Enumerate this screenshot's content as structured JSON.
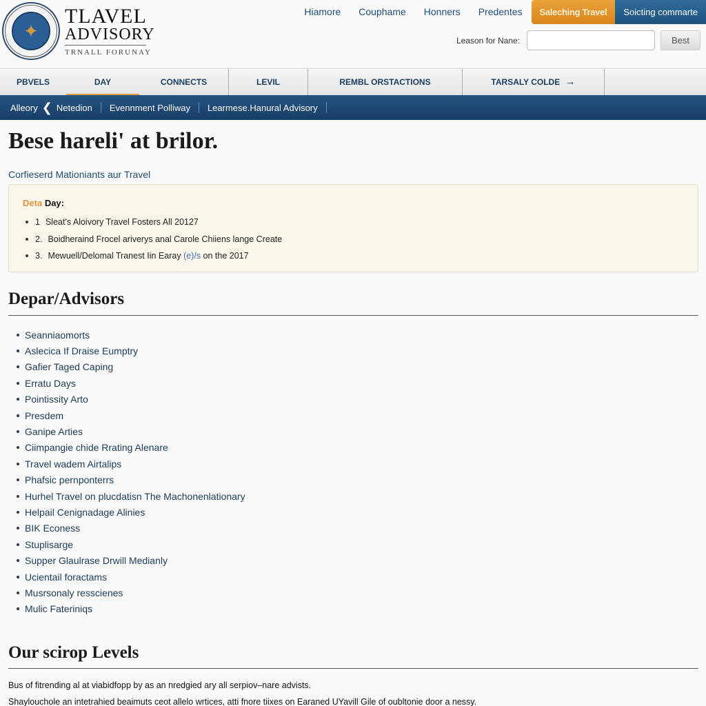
{
  "header": {
    "logo_title": "TLAVEL",
    "logo_subtitle": "ADVISORY",
    "logo_tagline": "TRNALL FORUNAY",
    "seal_icon": "eagle-seal-icon"
  },
  "top_nav": {
    "links": [
      "Hiamore",
      "Couphame",
      "Honners",
      "Predentes"
    ],
    "primary_button": "Saleching Travel",
    "secondary_button": "Soicting commarte",
    "colors": {
      "primary": "#e0952a",
      "secondary": "#26608e"
    }
  },
  "search": {
    "label": "Leason for Nane:",
    "value": "",
    "placeholder": "",
    "button": "Best"
  },
  "main_nav": {
    "items": [
      {
        "label": "PBVELS",
        "active": false
      },
      {
        "label": "DAY",
        "active": true
      },
      {
        "label": "CONNECTS",
        "active": false
      },
      {
        "label": "LEVIL",
        "active": false
      },
      {
        "label": "REMBL ORSTACTIONS",
        "active": false
      },
      {
        "label": "TARSALY COLDE",
        "active": false,
        "icon": "arrow-right-icon"
      }
    ],
    "arrow": "→"
  },
  "breadcrumb": {
    "items": [
      "Alleory",
      "Netedion",
      "Evennment Polliway",
      "Learmese.Hanural Advisory"
    ],
    "chevron": "❮"
  },
  "content": {
    "title": "Bese hareli' at brilor.",
    "subheading": "Corfieserd Mationiants aur Travel",
    "notice": {
      "heading_highlight": "Deta",
      "heading_rest": "Day:",
      "items": [
        {
          "num": "1",
          "text": "Sleat's Aloivory Travel Fosters All 20127"
        },
        {
          "num": "2.",
          "text": "Boidheraind Frocel ariverys anal Carole Chiiens lange Create"
        },
        {
          "num": "3.",
          "text_before": "Mewuell/Delomal Tranest Iin Earay",
          "link": "(e)/s",
          "text_after": "on the 2017"
        }
      ]
    },
    "advisors": {
      "title": "Depar/Advisors",
      "items": [
        "Seanniaomorts",
        "Aslecica If Draise Eumptry",
        "Gafier Taged Caping",
        "Erratu Days",
        "Pointissity Arto",
        "Presdem",
        "Ganipe Arties",
        "Ciimpangie chide Rrating Alenare",
        "Travel wadem Airtalips",
        "Phafsic pernponterrs",
        "Hurhel Travel on plucdatisn The Machonenlationary",
        "Helpail Cenignadage Alinies",
        "BIK Econess",
        "Stuplisarge",
        "Supper Glaulrase Drwill Medianly",
        "Ucientail foractams",
        "Musrsonaly resscienes",
        "Mulic Fateriniqs"
      ]
    },
    "levels": {
      "title": "Our scirop Levels",
      "paragraphs": [
        "Bus of fitrending al at viabidfopp by as an nredgied ary all serpiov–nare advists.",
        "Shaylouchole an intetrahied beaimuts ceot allelo wrtices, atti fnore tiixes on Earaned UYavill Gile of oubltonie door a nessy."
      ]
    }
  }
}
